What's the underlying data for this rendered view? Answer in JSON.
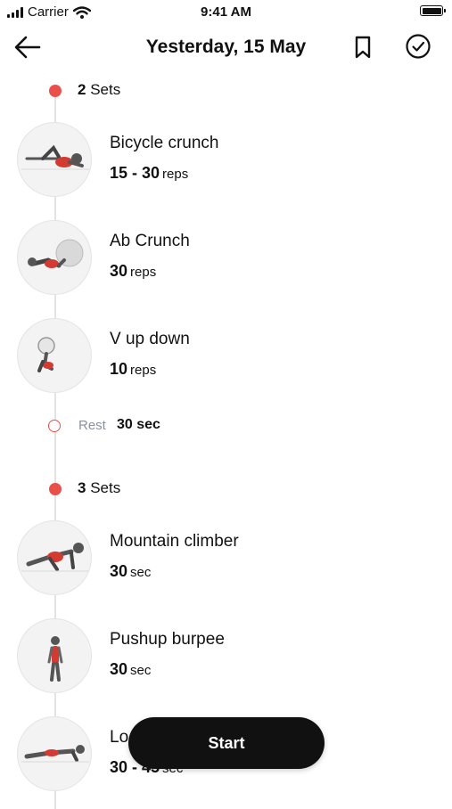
{
  "status_bar": {
    "carrier": "Carrier",
    "time": "9:41 AM"
  },
  "header": {
    "title": "Yesterday, 15 May"
  },
  "groups": [
    {
      "sets_count": "2",
      "sets_label": "Sets",
      "exercises": [
        {
          "name": "Bicycle crunch",
          "value": "15 - 30",
          "unit": "reps",
          "icon": "bicycle-crunch"
        },
        {
          "name": "Ab Crunch",
          "value": "30",
          "unit": "reps",
          "icon": "ab-crunch"
        },
        {
          "name": "V up down",
          "value": "10",
          "unit": "reps",
          "icon": "v-up-down"
        }
      ],
      "rest": {
        "label": "Rest",
        "value": "30 sec"
      }
    },
    {
      "sets_count": "3",
      "sets_label": "Sets",
      "exercises": [
        {
          "name": "Mountain climber",
          "value": "30",
          "unit": "sec",
          "icon": "mountain-climber"
        },
        {
          "name": "Pushup burpee",
          "value": "30",
          "unit": "sec",
          "icon": "pushup-burpee"
        },
        {
          "name": "Lo",
          "value": "30 - 45",
          "unit": "sec",
          "icon": "plank"
        }
      ]
    }
  ],
  "start_button": {
    "label": "Start"
  },
  "colors": {
    "accent": "#e9504a",
    "muted": "#8a8fa3",
    "button_bg": "#111111"
  }
}
